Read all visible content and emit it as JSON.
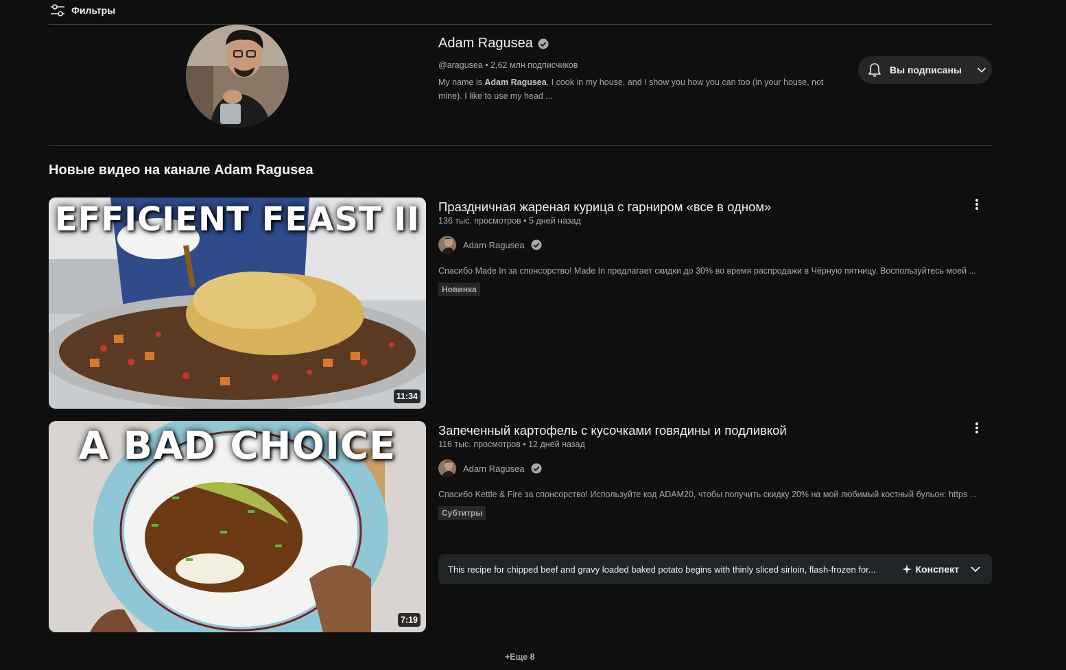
{
  "filters": {
    "label": "Фильтры"
  },
  "channel": {
    "name": "Adam Ragusea",
    "handle": "@aragusea",
    "separator": " • ",
    "subscribers": "2,62 млн подписчиков",
    "description_prefix": "My name is ",
    "description_bold": "Adam Ragusea",
    "description_rest": ". I cook in my house, and I show you how you can too (in your house, not mine). I like to use my head ...",
    "subscribe_button": "Вы подписаны"
  },
  "section": {
    "title": "Новые видео на канале Adam Ragusea"
  },
  "videos": [
    {
      "thumbnail_text": "EFFICIENT FEAST II",
      "duration": "11:34",
      "title": "Праздничная жареная курица с гарниром «все в одном»",
      "views": "136 тыс. просмотров",
      "separator": " • ",
      "age": "5 дней назад",
      "channel": "Adam Ragusea",
      "description": "Спасибо Made In за спонсорство! Made In предлагает скидки до 30% во время распродажи в Чёрную пятницу. Воспользуйтесь моей ...",
      "badge": "Новинка"
    },
    {
      "thumbnail_text": "A BAD CHOICE",
      "duration": "7:19",
      "title": "Запеченный картофель с кусочками говядины и подливкой",
      "views": "116 тыс. просмотров",
      "separator": " • ",
      "age": "12 дней назад",
      "channel": "Adam Ragusea",
      "description": "Спасибо Kettle & Fire за спонсорство! Используйте код ADAM20, чтобы получить скидку 20% на мой любимый костный бульон: https ...",
      "badge": "Субтитры",
      "summary_text": "This recipe for chipped beef and gravy loaded baked potato begins with thinly sliced sirloin, flash-frozen for...",
      "summary_button": "Конспект"
    }
  ],
  "show_more": "+Еще 8",
  "colors": {
    "background": "#0f0f0f",
    "surface": "#272727",
    "text_primary": "#f1f1f1",
    "text_secondary": "#aaaaaa"
  }
}
